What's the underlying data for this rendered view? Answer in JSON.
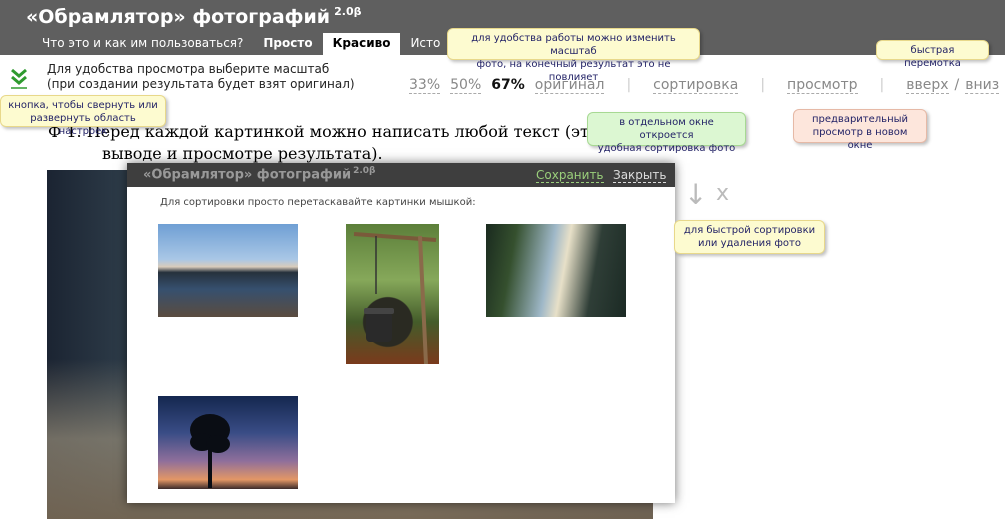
{
  "header": {
    "title": "«Обрамлятор» фотографий",
    "version": "2.0β",
    "nav": [
      {
        "label": "Что это и как им пользоваться?"
      },
      {
        "label": "Просто"
      },
      {
        "label": "Красиво"
      },
      {
        "label": "Исто"
      }
    ]
  },
  "settings": {
    "hint_line1": "Для удобства просмотра выберите масштаб",
    "hint_line2": "(при создании результата будет взят оригинал)",
    "scale_33": "33%",
    "scale_50": "50%",
    "scale_67": "67%",
    "scale_orig": "оригинал",
    "sort": "сортировка",
    "preview": "просмотр",
    "up": "вверх",
    "slash": "/",
    "down": "вниз"
  },
  "page": {
    "text_line1": "Ф    1. Перед каждой картинкой можно написать любой текст (эта т                  т виде",
    "text_line2": "выводе и просмотре результата)."
  },
  "sort_controls": {
    "arrow": "↓",
    "delete": "x"
  },
  "popup": {
    "title": "«Обрамлятор» фотографий",
    "version": "2.0β",
    "save": "Сохранить",
    "close": "Закрыть",
    "hint": "Для сортировки просто перетаскавайте картинки мышкой:"
  },
  "callouts": {
    "scale": "для удобства работы можно изменить масштаб\nфото, на конечный результат это не повлияет",
    "fast": "быстрая перемотка",
    "collapse": "кнопка, чтобы свернуть или\nразвернуть область настроек",
    "sort": "в отдельном окне откроется\nудобная сортировка фото",
    "preview": "предварительный\nпросмотр в новом окне",
    "quick": "для быстрой сортировки\nили удаления фото"
  },
  "colors": {
    "header_bg": "#5f5f5f",
    "callout_yellow": "#fdfbd0",
    "callout_pink": "#fde6dc",
    "callout_green": "#dcf7d2",
    "save_green": "#9acf7b"
  }
}
